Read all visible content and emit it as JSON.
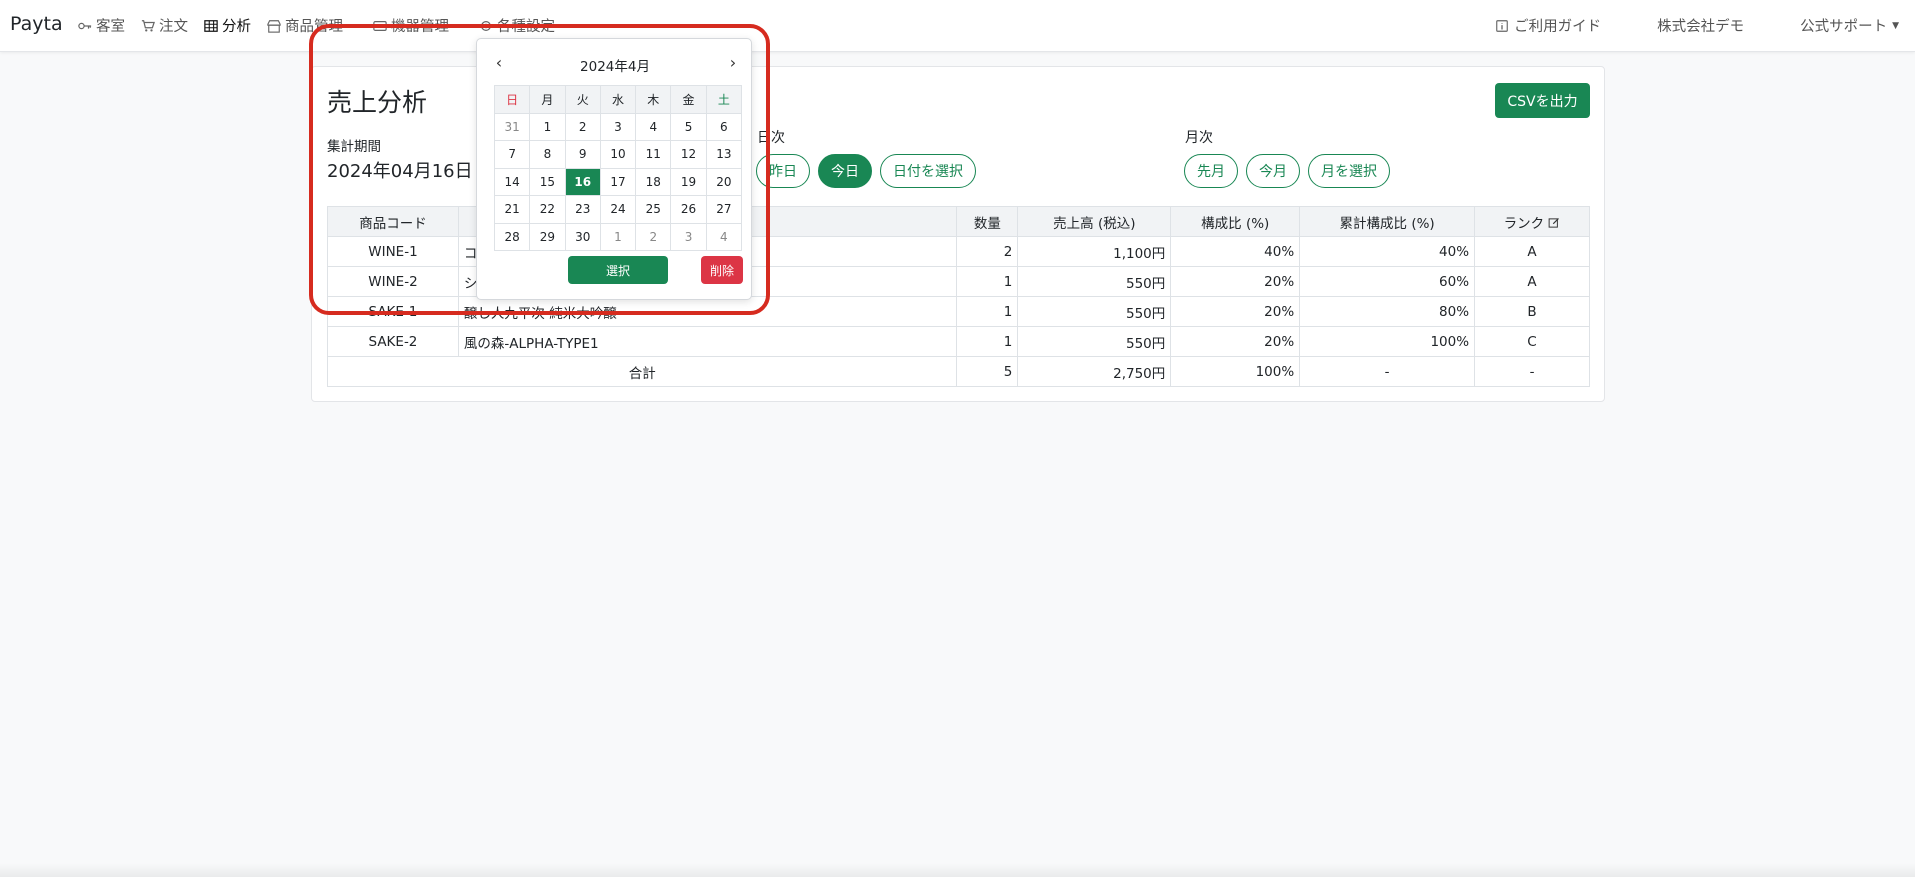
{
  "brand": "Payta",
  "nav": {
    "items": [
      {
        "label": "客室",
        "icon": "key-icon"
      },
      {
        "label": "注文",
        "icon": "cart-icon"
      },
      {
        "label": "分析",
        "icon": "table-icon"
      },
      {
        "label": "商品管理",
        "icon": "shop-icon"
      },
      {
        "label": "機器管理",
        "icon": "device-icon"
      },
      {
        "label": "各種設定",
        "icon": "gear-icon"
      }
    ],
    "guide": "ご利用ガイド",
    "company": "株式会社デモ",
    "support": "公式サポート"
  },
  "page": {
    "title": "売上分析",
    "csv_button": "CSVを出力",
    "period_label": "集計期間",
    "period_value": "2024年04月16日"
  },
  "daily": {
    "label": "日次",
    "yesterday": "昨日",
    "today": "今日",
    "pick": "日付を選択"
  },
  "monthly": {
    "label": "月次",
    "last": "先月",
    "this": "今月",
    "pick": "月を選択"
  },
  "table": {
    "headers": {
      "code": "商品コード",
      "name": "",
      "qty": "数量",
      "sales": "売上高 (税込)",
      "ratio": "構成比 (%)",
      "cum": "累計構成比 (%)",
      "rank": "ランク"
    },
    "rows": [
      {
        "code": "WINE-1",
        "name": "コ",
        "qty": "2",
        "sales": "1,100円",
        "ratio": "40%",
        "cum": "40%",
        "rank": "A"
      },
      {
        "code": "WINE-2",
        "name": "シ",
        "qty": "1",
        "sales": "550円",
        "ratio": "20%",
        "cum": "60%",
        "rank": "A"
      },
      {
        "code": "SAKE-1",
        "name": "醸し人九平次 純米大吟醸",
        "qty": "1",
        "sales": "550円",
        "ratio": "20%",
        "cum": "80%",
        "rank": "B"
      },
      {
        "code": "SAKE-2",
        "name": "風の森-ALPHA-TYPE1",
        "qty": "1",
        "sales": "550円",
        "ratio": "20%",
        "cum": "100%",
        "rank": "C"
      }
    ],
    "total": {
      "label": "合計",
      "qty": "5",
      "sales": "2,750円",
      "ratio": "100%",
      "cum": "-",
      "rank": "-"
    }
  },
  "datepicker": {
    "month_title": "2024年4月",
    "prev": "‹",
    "next": "›",
    "weekdays": [
      "日",
      "月",
      "火",
      "水",
      "木",
      "金",
      "土"
    ],
    "weeks": [
      [
        "31",
        "1",
        "2",
        "3",
        "4",
        "5",
        "6"
      ],
      [
        "7",
        "8",
        "9",
        "10",
        "11",
        "12",
        "13"
      ],
      [
        "14",
        "15",
        "16",
        "17",
        "18",
        "19",
        "20"
      ],
      [
        "21",
        "22",
        "23",
        "24",
        "25",
        "26",
        "27"
      ],
      [
        "28",
        "29",
        "30",
        "1",
        "2",
        "3",
        "4"
      ]
    ],
    "selected": "16",
    "select_button": "選択",
    "clear_button": "削除"
  },
  "colors": {
    "primary": "#198754",
    "danger": "#dc3545",
    "highlight": "#d62b1f"
  }
}
